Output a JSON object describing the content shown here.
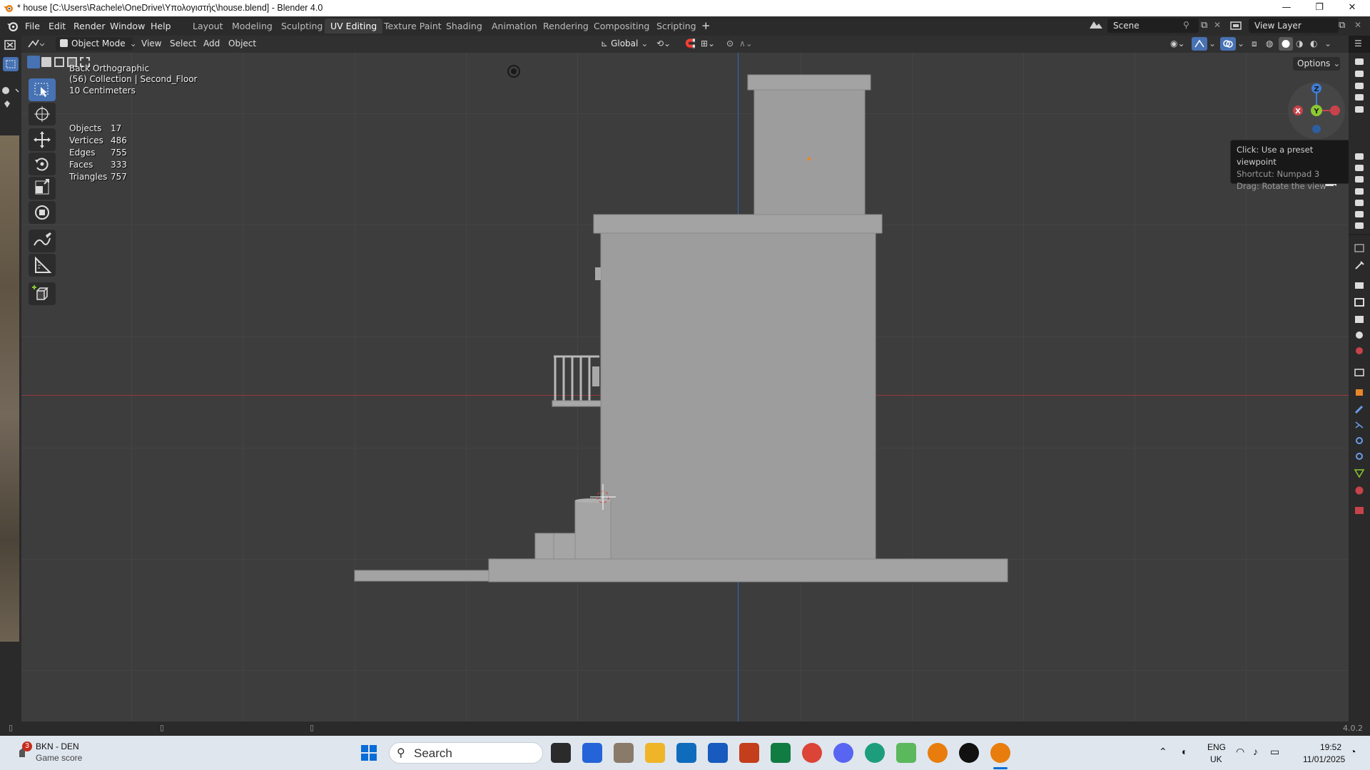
{
  "window": {
    "title": "* house [C:\\Users\\Rachele\\OneDrive\\Υπολογιστής\\house.blend] - Blender 4.0",
    "minimize": "—",
    "maximize": "❐",
    "close": "✕"
  },
  "menubar": {
    "items": [
      "File",
      "Edit",
      "Render",
      "Window",
      "Help"
    ],
    "workspaces": [
      "Layout",
      "Modeling",
      "Sculpting",
      "UV Editing",
      "Texture Paint",
      "Shading",
      "Animation",
      "Rendering",
      "Compositing",
      "Scripting"
    ],
    "active_workspace": "UV Editing",
    "add_workspace": "+",
    "scene": "Scene",
    "view_layer": "View Layer"
  },
  "viewport_header": {
    "mode": "Object Mode",
    "menus": [
      "View",
      "Select",
      "Add",
      "Object"
    ],
    "transform_orientation": "Global",
    "options": "Options"
  },
  "viewport_overlay": {
    "view_name": "Back Orthographic",
    "collection": "(56) Collection | Second_Floor",
    "scale": "10 Centimeters",
    "stats": [
      {
        "label": "Objects",
        "value": "17"
      },
      {
        "label": "Vertices",
        "value": "486"
      },
      {
        "label": "Edges",
        "value": "755"
      },
      {
        "label": "Faces",
        "value": "333"
      },
      {
        "label": "Triangles",
        "value": "757"
      }
    ]
  },
  "gizmo": {
    "z": "Z",
    "y": "Y",
    "x": "X"
  },
  "tooltip": {
    "line1": "Click: Use a preset viewpoint",
    "line2": "Shortcut: Numpad 3",
    "line3": "Drag: Rotate the view"
  },
  "statusbar": {
    "version": "4.0.2"
  },
  "taskbar": {
    "widget_title": "BKN - DEN",
    "widget_sub": "Game score",
    "widget_badge": "3",
    "search_placeholder": "Search",
    "lang": "ENG",
    "region": "UK",
    "time": "19:52",
    "date": "11/01/2025"
  },
  "colors": {
    "accent": "#4772b3",
    "axis_x": "#c8424a",
    "axis_y": "#8cc833",
    "axis_z": "#3e7ed8",
    "mesh": "#a0a0a0"
  }
}
